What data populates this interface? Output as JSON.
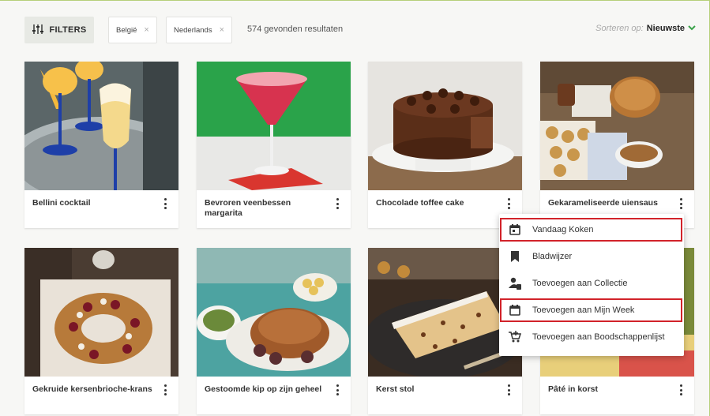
{
  "toolbar": {
    "filters_label": "FILTERS",
    "chips": [
      {
        "label": "België"
      },
      {
        "label": "Nederlands"
      }
    ],
    "chip_remove_glyph": "×",
    "results_text": "574 gevonden resultaten",
    "sort_label": "Sorteren op:",
    "sort_value": "Nieuwste"
  },
  "recipes": [
    {
      "title": "Bellini cocktail"
    },
    {
      "title": "Bevroren veenbessen margarita"
    },
    {
      "title": "Chocolade toffee cake"
    },
    {
      "title": "Gekarameliseerde uiensaus"
    },
    {
      "title": "Gekruide kersenbrioche-krans"
    },
    {
      "title": "Gestoomde kip op zijn geheel"
    },
    {
      "title": "Kerst stol"
    },
    {
      "title": "Pâté in korst"
    }
  ],
  "context_menu": {
    "items": [
      {
        "label": "Vandaag Koken",
        "icon": "calendar-today-icon",
        "highlighted": true
      },
      {
        "label": "Bladwijzer",
        "icon": "bookmark-icon",
        "highlighted": false
      },
      {
        "label": "Toevoegen aan Collectie",
        "icon": "collection-icon",
        "highlighted": false
      },
      {
        "label": "Toevoegen aan Mijn Week",
        "icon": "calendar-week-icon",
        "highlighted": true
      },
      {
        "label": "Toevoegen aan Boodschappenlijst",
        "icon": "cart-add-icon",
        "highlighted": false
      }
    ]
  },
  "colors": {
    "accent_green": "#3aa24a",
    "highlight_red": "#d2232a"
  }
}
